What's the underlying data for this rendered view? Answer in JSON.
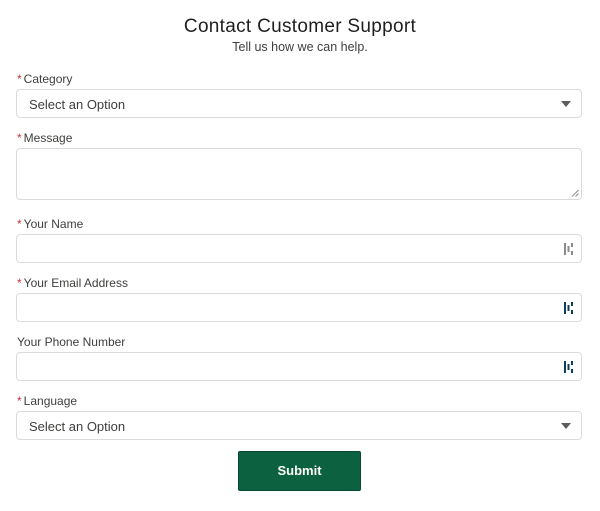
{
  "form": {
    "title": "Contact Customer Support",
    "subtitle": "Tell us how we can help.",
    "required_marker": "*",
    "fields": {
      "category": {
        "label": "Category",
        "required": true,
        "selected": "Select an Option"
      },
      "message": {
        "label": "Message",
        "required": true,
        "value": ""
      },
      "name": {
        "label": "Your Name",
        "required": true,
        "value": "",
        "icon": "password-manager-icon"
      },
      "email": {
        "label": "Your Email Address",
        "required": true,
        "value": "",
        "icon": "password-manager-icon"
      },
      "phone": {
        "label": "Your Phone Number",
        "required": false,
        "value": "",
        "icon": "password-manager-icon"
      },
      "language": {
        "label": "Language",
        "required": true,
        "selected": "Select an Option"
      }
    },
    "submit_label": "Submit"
  },
  "colors": {
    "required": "#c23934",
    "submit_bg": "#0c6140",
    "border": "#dddbda",
    "icon_gray": "#8a8a8a",
    "icon_dark": "#0b3d5c"
  }
}
